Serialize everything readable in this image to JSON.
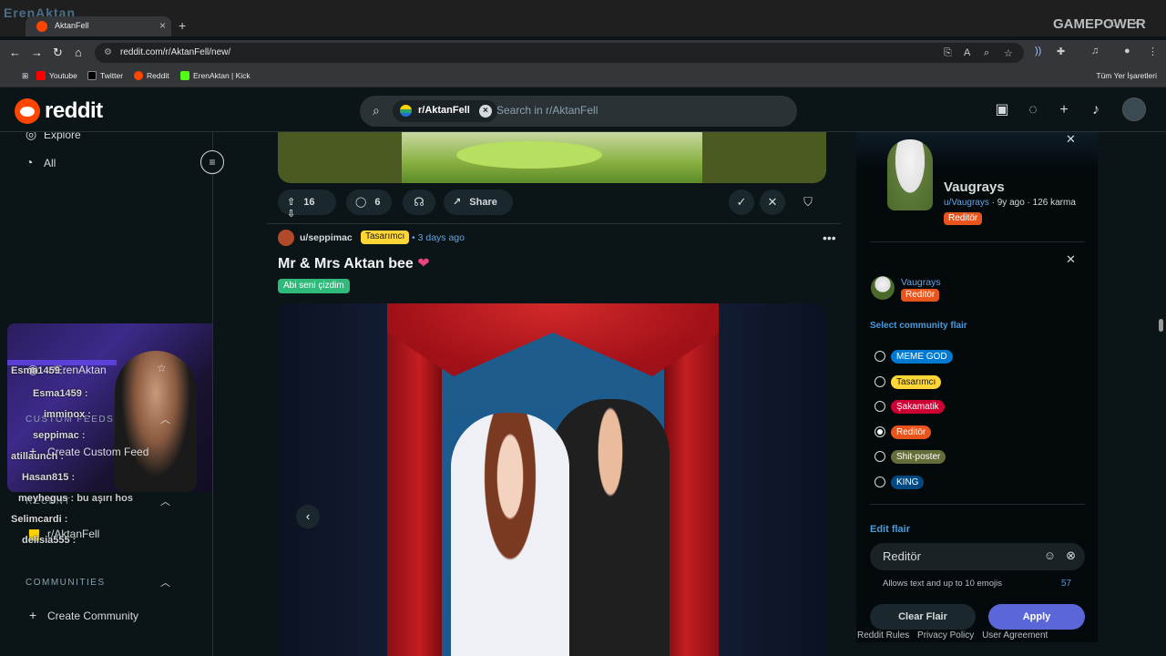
{
  "browser": {
    "tab_title": "AktanFell",
    "overlay_logo": "ErenAktan",
    "url": "reddit.com/r/AktanFell/new/",
    "bookmarks": [
      "Youtube",
      "Twitter",
      "Reddit",
      "ErenAktan | Kick"
    ],
    "all_bookmarks": "Tüm Yer İşaretleri",
    "stream_logo": "GAMEPOWER"
  },
  "header": {
    "logo_text": "reddit",
    "search_chip": "r/AktanFell",
    "search_placeholder": "Search in r/AktanFell"
  },
  "leftnav": {
    "explore": "Explore",
    "all": "All",
    "subreddit_fav": "r/ErenAktan",
    "custom_feeds": "CUSTOM FEEDS",
    "create_custom_feed": "Create Custom Feed",
    "recent": "RECENT",
    "recent_item": "r/AktanFell",
    "communities": "COMMUNITIES",
    "create_community": "Create Community"
  },
  "chat": [
    {
      "user": "Esma1459",
      "msg": ":"
    },
    {
      "user": "Esma1459",
      "msg": ":"
    },
    {
      "user": "imminox",
      "msg": ":"
    },
    {
      "user": "seppimac",
      "msg": ":"
    },
    {
      "user": "atillaunch",
      "msg": ":"
    },
    {
      "user": "Hasan815",
      "msg": ":"
    },
    {
      "user": "meyhegus",
      "msg": ": bu aşırı hos"
    },
    {
      "user": "Selimcardi",
      "msg": ":"
    },
    {
      "user": "delisia555",
      "msg": ":"
    }
  ],
  "prev_post": {
    "upvotes": "16",
    "comments": "6",
    "share": "Share"
  },
  "post": {
    "author": "u/seppimac",
    "author_flair": "Tasarımcı",
    "time": "3 days ago",
    "title": "Mr & Mrs Aktan bee",
    "title_emoji": "❤",
    "post_flair": "Abi seni çizdim"
  },
  "user_panel": {
    "name": "Vaugrays",
    "meta_user": "u/Vaugrays",
    "meta_rest": " · 9y ago · 126 karma",
    "flair": "Reditör"
  },
  "flair_editor": {
    "user": "Vaugrays",
    "current_flair": "Reditör",
    "select_label": "Select community flair",
    "options": [
      {
        "label": "MEME GOD",
        "bg": "#0079d3",
        "fg": "#ffffff",
        "selected": false
      },
      {
        "label": "Tasarımcı",
        "bg": "#ffd635",
        "fg": "#1a1a1a",
        "selected": false
      },
      {
        "label": "Şakamatik",
        "bg": "#cc0033",
        "fg": "#ffffff",
        "selected": false
      },
      {
        "label": "Reditör",
        "bg": "#e8541c",
        "fg": "#ffffff",
        "selected": true
      },
      {
        "label": "Shit-poster",
        "bg": "#646d3a",
        "fg": "#ffffff",
        "selected": false
      },
      {
        "label": "KING",
        "bg": "#014980",
        "fg": "#ffffff",
        "selected": false
      }
    ],
    "edit_label": "Edit flair",
    "edit_value": "Reditör",
    "hint": "Allows text and up to 10 emojis",
    "count": "57",
    "clear": "Clear Flair",
    "apply": "Apply"
  },
  "footer": [
    "Reddit Rules",
    "Privacy Policy",
    "User Agreement"
  ],
  "colors": {
    "brand": "#ff4500",
    "accent_blue": "#4a9ad8",
    "apply": "#5b67d8",
    "background": "#0b1416"
  }
}
